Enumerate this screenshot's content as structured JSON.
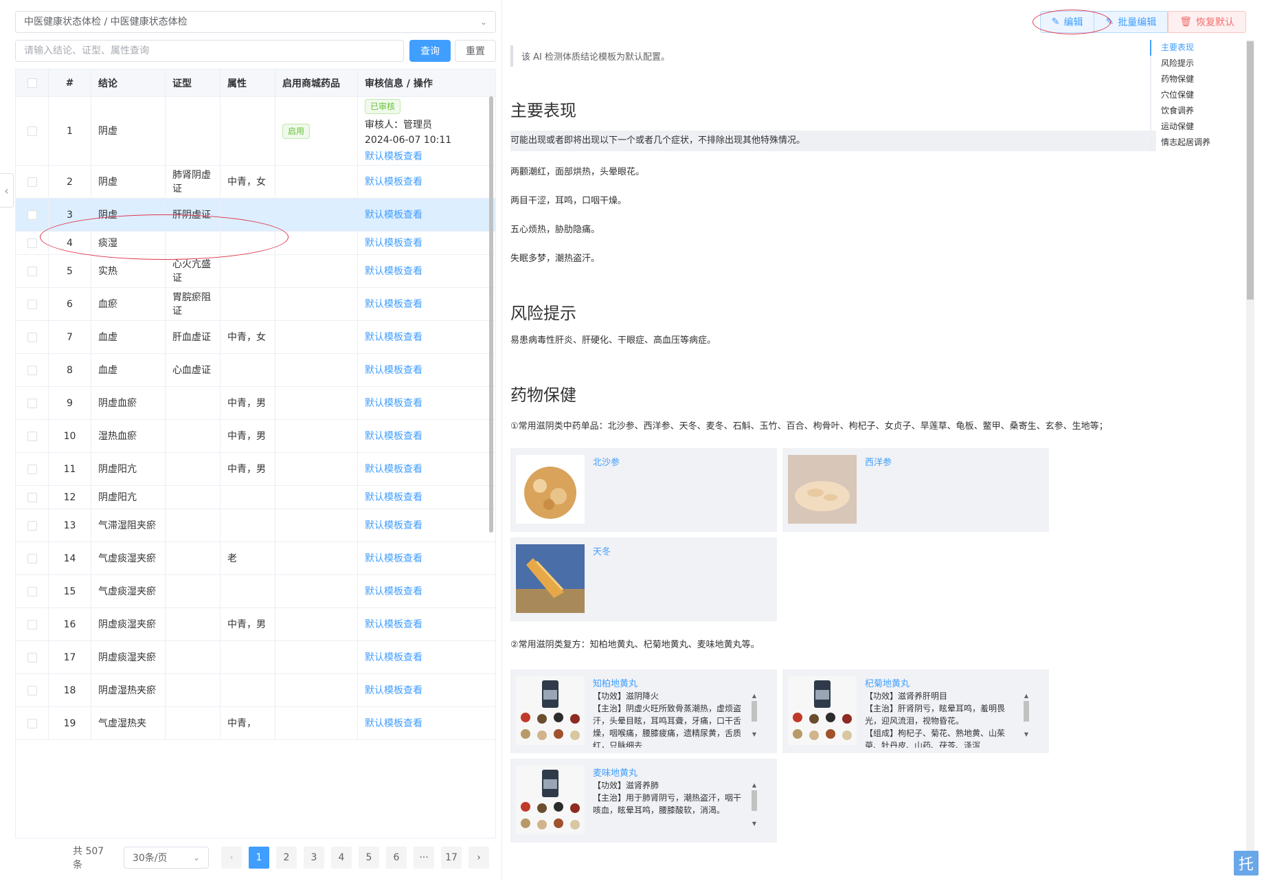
{
  "cascader": {
    "value": "中医健康状态体检 / 中医健康状态体检"
  },
  "search": {
    "placeholder": "请输入结论、证型、属性查询",
    "query": "查询",
    "reset": "重置"
  },
  "table": {
    "headers": [
      "#",
      "结论",
      "证型",
      "属性",
      "启用商城药品",
      "审核信息 / 操作"
    ],
    "status_tag": "已审核",
    "reviewer": "审核人：管理员",
    "review_time": "2024-06-07 10:11",
    "enabled_tag": "启用",
    "action": "默认模板查看",
    "rows": [
      {
        "n": "1",
        "conclusion": "阴虚",
        "type": "",
        "attr": ""
      },
      {
        "n": "2",
        "conclusion": "阴虚",
        "type": "肺肾阴虚证",
        "attr": "中青，女"
      },
      {
        "n": "3",
        "conclusion": "阴虚",
        "type": "肝阴虚证",
        "attr": ""
      },
      {
        "n": "4",
        "conclusion": "痰湿",
        "type": "",
        "attr": ""
      },
      {
        "n": "5",
        "conclusion": "实热",
        "type": "心火亢盛证",
        "attr": ""
      },
      {
        "n": "6",
        "conclusion": "血瘀",
        "type": "胃脘瘀阻证",
        "attr": ""
      },
      {
        "n": "7",
        "conclusion": "血虚",
        "type": "肝血虚证",
        "attr": "中青，女"
      },
      {
        "n": "8",
        "conclusion": "血虚",
        "type": "心血虚证",
        "attr": ""
      },
      {
        "n": "9",
        "conclusion": "阴虚血瘀",
        "type": "",
        "attr": "中青，男"
      },
      {
        "n": "10",
        "conclusion": "湿热血瘀",
        "type": "",
        "attr": "中青，男"
      },
      {
        "n": "11",
        "conclusion": "阴虚阳亢",
        "type": "",
        "attr": "中青，男"
      },
      {
        "n": "12",
        "conclusion": "阴虚阳亢",
        "type": "",
        "attr": ""
      },
      {
        "n": "13",
        "conclusion": "气滞湿阻夹瘀",
        "type": "",
        "attr": ""
      },
      {
        "n": "14",
        "conclusion": "气虚痰湿夹瘀",
        "type": "",
        "attr": "老"
      },
      {
        "n": "15",
        "conclusion": "气虚痰湿夹瘀",
        "type": "",
        "attr": ""
      },
      {
        "n": "16",
        "conclusion": "阴虚痰湿夹瘀",
        "type": "",
        "attr": "中青，男"
      },
      {
        "n": "17",
        "conclusion": "阴虚痰湿夹瘀",
        "type": "",
        "attr": ""
      },
      {
        "n": "18",
        "conclusion": "阴虚湿热夹瘀",
        "type": "",
        "attr": ""
      },
      {
        "n": "19",
        "conclusion": "气虚湿热夹",
        "type": "",
        "attr": "中青，"
      }
    ]
  },
  "pager": {
    "total": "共 507 条",
    "size": "30条/页",
    "pages": [
      "1",
      "2",
      "3",
      "4",
      "5",
      "6",
      "···",
      "17"
    ]
  },
  "toolbar": {
    "edit": "编辑",
    "batch": "批量编辑",
    "restore": "恢复默认"
  },
  "notice": "该 AI 检测体质结论模板为默认配置。",
  "sections": {
    "s1": {
      "title": "主要表现",
      "intro": "可能出现或者即将出现以下一个或者几个症状，不排除出现其他特殊情况。",
      "lines": [
        "两颧潮红，面部烘热，头晕眼花。",
        "两目干涩，耳鸣，口咽干燥。",
        "五心烦热，胁肋隐痛。",
        "失眠多梦，潮热盗汗。"
      ]
    },
    "s2": {
      "title": "风险提示",
      "text": "易患病毒性肝炎、肝硬化、干眼症、高血压等病症。"
    },
    "s3": {
      "title": "药物保健",
      "p1": "①常用滋阴类中药单品：北沙参、西洋参、天冬、麦冬、石斛、玉竹、百合、枸骨叶、枸杞子、女贞子、旱莲草、龟板、鳖甲、桑寄生、玄参、生地等；",
      "herbs": [
        "北沙参",
        "西洋参",
        "天冬"
      ],
      "p2": "②常用滋阴类复方：知柏地黄丸、杞菊地黄丸、麦味地黄丸等。",
      "formulas": [
        {
          "name": "知柏地黄丸",
          "desc": "【功效】滋阴降火\n【主治】阴虚火旺所致骨蒸潮热，虚烦盗汗，头晕目眩，耳鸣耳聋，牙痛，口干舌燥，咽喉痛，腰膝疲痛，遗精尿黄，舌质红，只脉细去"
        },
        {
          "name": "杞菊地黄丸",
          "desc": "【功效】滋肾养肝明目\n【主治】肝肾阴亏，眩晕耳鸣，羞明畏光，迎风流泪，视物昏花。\n【组成】枸杞子、菊花、熟地黄、山茱萸、牡丹皮、山药、茯苓、泽泻"
        },
        {
          "name": "麦味地黄丸",
          "desc": "【功效】滋肾养肺\n【主治】用于肺肾阴亏，潮热盗汗，咽干咳血，眩晕耳鸣，腰膝酸软，消渴。"
        }
      ]
    }
  },
  "toc": [
    "主要表现",
    "风险提示",
    "药物保健",
    "穴位保健",
    "饮食调养",
    "运动保健",
    "情志起居调养"
  ],
  "corner": "托"
}
